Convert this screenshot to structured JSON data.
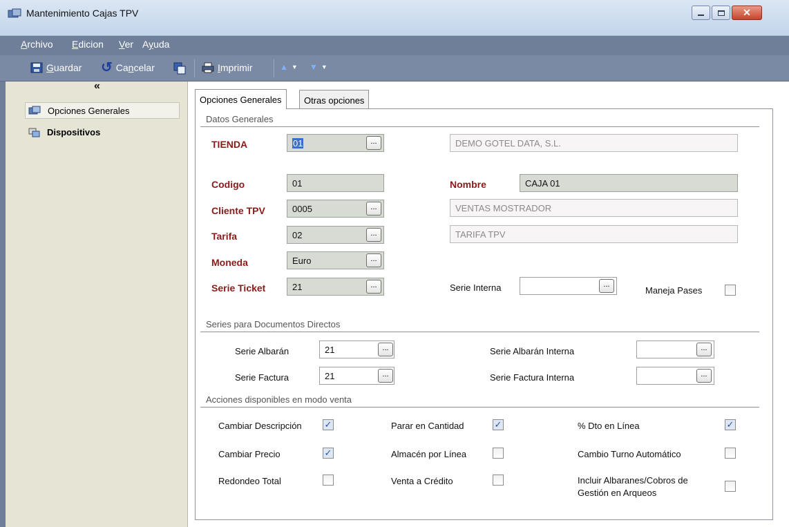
{
  "window": {
    "title": "Mantenimiento Cajas TPV"
  },
  "menu": [
    {
      "u": "A",
      "rest": "rchivo"
    },
    {
      "u": "E",
      "rest": "dicion"
    },
    {
      "u": "V",
      "rest": "er"
    },
    {
      "pre": "A",
      "u": "y",
      "rest": "uda"
    }
  ],
  "toolbar": {
    "save_u": "G",
    "save_rest": "uardar",
    "cancel_pre": "Ca",
    "cancel_u": "n",
    "cancel_rest": "celar",
    "print_u": "I",
    "print_rest": "mprimir"
  },
  "sidebar": {
    "collapse": "«",
    "items": [
      {
        "label": "Opciones Generales",
        "icon": "config-icon"
      },
      {
        "label": "Dispositivos",
        "icon": "devices-icon"
      }
    ]
  },
  "tabs": [
    {
      "label": "Opciones Generales"
    },
    {
      "label": "Otras opciones"
    }
  ],
  "general": {
    "section_title": "Datos Generales",
    "tienda_label": "TIENDA",
    "tienda_value": "01",
    "tienda_desc": "DEMO GOTEL DATA, S.L.",
    "codigo_label": "Codigo",
    "codigo_value": "01",
    "nombre_label": "Nombre",
    "nombre_value": "CAJA 01",
    "cliente_label": "Cliente TPV",
    "cliente_value": "0005",
    "cliente_desc": "VENTAS MOSTRADOR",
    "tarifa_label": "Tarifa",
    "tarifa_value": "02",
    "tarifa_desc": "TARIFA TPV",
    "moneda_label": "Moneda",
    "moneda_value": "Euro",
    "serie_ticket_label": "Serie Ticket",
    "serie_ticket_value": "21",
    "serie_interna_label": "Serie Interna",
    "serie_interna_value": "",
    "maneja_pases_label": "Maneja Pases",
    "maneja_pases_checked": false,
    "dots": "..."
  },
  "series": {
    "section_title": "Series para Documentos Directos",
    "albaran_label": "Serie Albarán",
    "albaran_value": "21",
    "factura_label": "Serie Factura",
    "factura_value": "21",
    "albaran_interna_label": "Serie Albarán Interna",
    "albaran_interna_value": "",
    "factura_interna_label": "Serie Factura Interna",
    "factura_interna_value": ""
  },
  "acciones": {
    "section_title": "Acciones disponibles en modo venta",
    "items": [
      {
        "label": "Cambiar Descripción",
        "checked": true
      },
      {
        "label": "Parar en Cantidad",
        "checked": true
      },
      {
        "label": "% Dto en Línea",
        "checked": true
      },
      {
        "label": "Cambiar Precio",
        "checked": true
      },
      {
        "label": "Almacén por Línea",
        "checked": false
      },
      {
        "label": "Cambio Turno Automático",
        "checked": false
      },
      {
        "label": "Redondeo Total",
        "checked": false
      },
      {
        "label": "Venta a Crédito",
        "checked": false
      },
      {
        "label": "Incluir Albaranes/Cobros de",
        "label2": "Gestión en Arqueos",
        "checked": false
      }
    ],
    "check_glyph": "✓"
  }
}
